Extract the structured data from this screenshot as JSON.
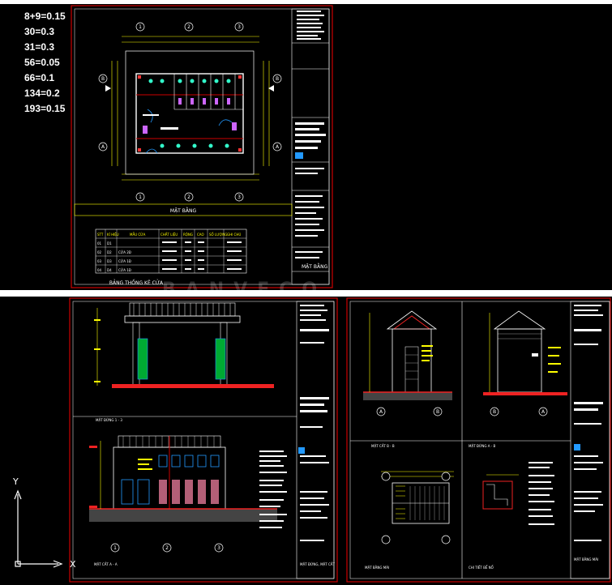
{
  "notes": [
    "8+9=0.15",
    "30=0.3",
    "31=0.3",
    "56=0.05",
    "66=0.1",
    "134=0.2",
    "193=0.15"
  ],
  "top_sheet": {
    "plan_title": "MẶT BẰNG",
    "table_title": "BẢNG THỐNG KÊ CỬA",
    "sheet_name": "MẶT BẰNG",
    "table_headers": [
      "STT",
      "KÍ HIỆU",
      "MẪU CỬA",
      "CHẤT LIỆU",
      "RỘNG",
      "CAO",
      "SỐ LƯỢNG",
      "GHI CHÚ"
    ],
    "table_rows": [
      [
        "01",
        "D1",
        "",
        "",
        "",
        "",
        "",
        ""
      ],
      [
        "02",
        "D2",
        "CỬA 2Đ",
        "",
        "",
        "",
        "",
        ""
      ],
      [
        "03",
        "D3",
        "CỬA 1Đ",
        "",
        "",
        "",
        "",
        ""
      ],
      [
        "04",
        "D4",
        "CỬA 1Đ",
        "",
        "",
        "",
        "",
        ""
      ]
    ]
  },
  "bottom_sheets": {
    "elev_1_3": "MẶT ĐỨNG 1 - 3",
    "section_aa": "MẶT CẮT A - A",
    "section_bb": "MẶT CẮT B - B",
    "elev_ab": "MẶT ĐỨNG A - B",
    "roof_plan": "MẶT BẰNG MÁI",
    "detail": "CHI TIẾT BỂ NỔ",
    "sheet_left": "MẶT ĐỨNG, MẶT CẮT",
    "sheet_right": "MẶT BẰNG MÁI"
  },
  "grid_labels": [
    "1",
    "2",
    "3",
    "A",
    "B"
  ],
  "ucs": {
    "x_axis": "X",
    "y_axis": "Y"
  },
  "watermark": "BANVECO"
}
